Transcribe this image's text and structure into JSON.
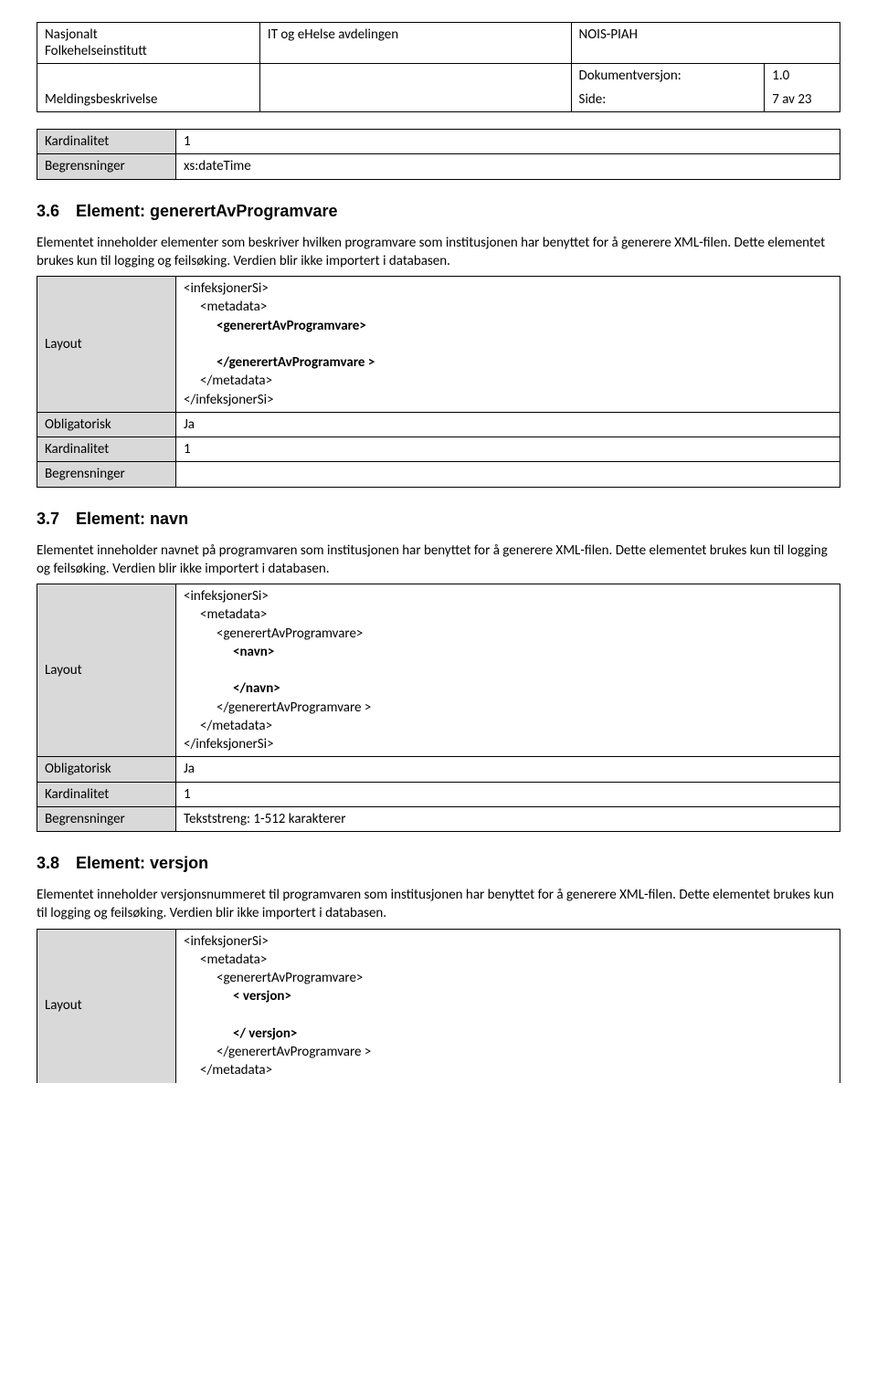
{
  "header": {
    "org1": "Nasjonalt",
    "org2": "Folkehelseinstitutt",
    "dept": "IT og eHelse avdelingen",
    "system": "NOIS-PIAH",
    "doc_desc": "Meldingsbeskrivelse",
    "version_label": "Dokumentversjon:",
    "version": "1.0",
    "page_label": "Side:",
    "page": "7 av 23"
  },
  "topTable": {
    "kardinalitet_label": "Kardinalitet",
    "kardinalitet_value": "1",
    "begrensninger_label": "Begrensninger",
    "begrensninger_value": "xs:dateTime"
  },
  "sec36": {
    "num": "3.6",
    "title": "Element: generertAvProgramvare",
    "desc": "Elementet inneholder elementer som beskriver hvilken programvare som institusjonen har benyttet for å generere XML-filen. Dette elementet brukes kun til logging og feilsøking. Verdien blir ikke importert i databasen.",
    "layout_label": "Layout",
    "obligatorisk_label": "Obligatorisk",
    "obligatorisk_value": "Ja",
    "kardinalitet_label": "Kardinalitet",
    "kardinalitet_value": "1",
    "begrensninger_label": "Begrensninger",
    "begrensninger_value": "",
    "code": {
      "l1": "<infeksjonerSi>",
      "l2": "<metadata>",
      "l3": "<generertAvProgramvare>",
      "l4": "</generertAvProgramvare >",
      "l5": "</metadata>",
      "l6": "</infeksjonerSi>"
    }
  },
  "sec37": {
    "num": "3.7",
    "title": "Element: navn",
    "desc": "Elementet inneholder navnet på programvaren som institusjonen har benyttet for å generere XML-filen. Dette elementet brukes kun til logging og feilsøking. Verdien blir ikke importert i databasen.",
    "layout_label": "Layout",
    "obligatorisk_label": "Obligatorisk",
    "obligatorisk_value": "Ja",
    "kardinalitet_label": "Kardinalitet",
    "kardinalitet_value": "1",
    "begrensninger_label": "Begrensninger",
    "begrensninger_value": "Tekststreng: 1-512 karakterer",
    "code": {
      "l1": "<infeksjonerSi>",
      "l2": "<metadata>",
      "l3": "<generertAvProgramvare>",
      "l4": "<navn>",
      "l5": "</navn>",
      "l6": "</generertAvProgramvare >",
      "l7": "</metadata>",
      "l8": "</infeksjonerSi>"
    }
  },
  "sec38": {
    "num": "3.8",
    "title": "Element: versjon",
    "desc": "Elementet inneholder versjonsnummeret til programvaren som institusjonen har benyttet for å generere XML-filen. Dette elementet brukes kun til logging og feilsøking. Verdien blir ikke importert i databasen.",
    "layout_label": "Layout",
    "code": {
      "l1": "<infeksjonerSi>",
      "l2": "<metadata>",
      "l3": "<generertAvProgramvare>",
      "l4": "< versjon>",
      "l5": "</ versjon>",
      "l6": "</generertAvProgramvare >",
      "l7": "</metadata>"
    }
  }
}
